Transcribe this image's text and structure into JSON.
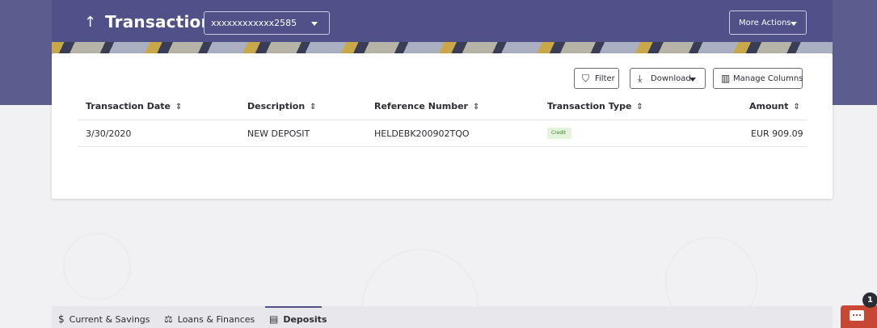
{
  "header": {
    "back_icon": "arrow-up-icon",
    "title": "Transactions",
    "account_selected": "xxxxxxxxxxxx2585",
    "more_actions_label": "More Actions"
  },
  "toolbar": {
    "filter_label": "Filter",
    "download_label": "Download",
    "manage_columns_label": "Manage Columns"
  },
  "table": {
    "columns": [
      "Transaction Date",
      "Description",
      "Reference Number",
      "Transaction Type",
      "Amount"
    ],
    "rows": [
      {
        "date": "3/30/2020",
        "description": "NEW DEPOSIT",
        "reference": "HELDEBK200902TQO",
        "type": "Credit",
        "amount": "EUR 909.09"
      }
    ]
  },
  "tabs": [
    {
      "label": "Current & Savings",
      "icon": "dollar-circle-icon",
      "active": false
    },
    {
      "label": "Loans & Finances",
      "icon": "loan-icon",
      "active": false
    },
    {
      "label": "Deposits",
      "icon": "deposits-icon",
      "active": true
    }
  ],
  "chat": {
    "badge_count": "1"
  },
  "colors": {
    "banner": "#5b5d8f",
    "accent": "#4f5188",
    "credit_badge_bg": "#e4f4dc",
    "chat_button": "#c74634"
  }
}
